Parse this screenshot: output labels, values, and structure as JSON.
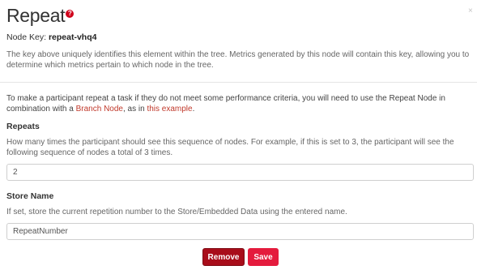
{
  "dialog": {
    "title": "Repeat",
    "help_icon_glyph": "?",
    "close_glyph": "×",
    "node_key_label": "Node Key:",
    "node_key_value": "repeat-vhq4",
    "description": "The key above uniquely identifies this element within the tree. Metrics generated by this node will contain this key, allowing you to determine which metrics pertain to which node in the tree."
  },
  "intro": {
    "text_1": "To make a participant repeat a task if they do not meet some performance criteria, you will need to use the Repeat Node in combination with a ",
    "link_1": "Branch Node",
    "text_2": ", as in ",
    "link_2": "this example",
    "text_3": "."
  },
  "repeats": {
    "label": "Repeats",
    "help": "How many times the participant should see this sequence of nodes. For example, if this is set to 3, the participant will see the following sequence of nodes a total of 3 times.",
    "value": "2"
  },
  "store_name": {
    "label": "Store Name",
    "help": "If set, store the current repetition number to the Store/Embedded Data using the entered name.",
    "value": "RepeatNumber"
  },
  "buttons": {
    "remove": "Remove",
    "save": "Save"
  },
  "colors": {
    "accent": "#e41b3d",
    "remove": "#a80d1a",
    "link": "#c0392b",
    "help_icon": "#d0021b"
  },
  "icons": {
    "help": "question-circle-icon",
    "close": "close-icon"
  }
}
